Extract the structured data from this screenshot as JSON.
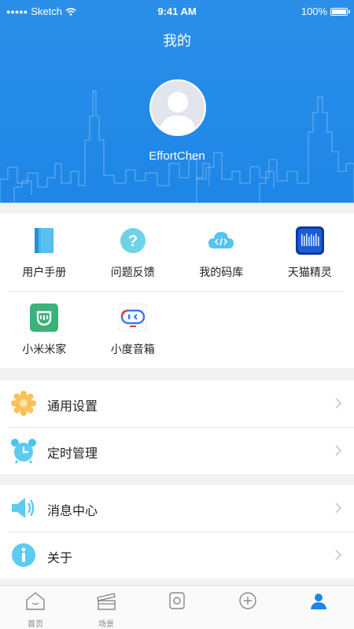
{
  "status_bar": {
    "carrier": "Sketch",
    "time": "9:41 AM",
    "battery": "100%"
  },
  "header": {
    "title": "我的",
    "username": "EffortChen"
  },
  "shortcuts": [
    {
      "label": "用户手册",
      "icon": "manual-book-icon"
    },
    {
      "label": "问题反馈",
      "icon": "question-feedback-icon"
    },
    {
      "label": "我的码库",
      "icon": "code-cloud-icon"
    },
    {
      "label": "天猫精灵",
      "icon": "tmall-genie-icon"
    },
    {
      "label": "小米米家",
      "icon": "mijia-icon"
    },
    {
      "label": "小度音箱",
      "icon": "xiaodu-speaker-icon"
    }
  ],
  "settings_group_1": [
    {
      "label": "通用设置",
      "icon": "gear-icon"
    },
    {
      "label": "定时管理",
      "icon": "alarm-clock-icon"
    }
  ],
  "settings_group_2": [
    {
      "label": "消息中心",
      "icon": "speaker-icon"
    },
    {
      "label": "关于",
      "icon": "info-icon"
    }
  ],
  "tabs": [
    {
      "label": "首页",
      "icon": "home-icon",
      "active": false
    },
    {
      "label": "场景",
      "icon": "scene-icon",
      "active": false
    },
    {
      "label": "",
      "icon": "devices-icon",
      "active": false
    },
    {
      "label": "",
      "icon": "smart-icon",
      "active": false
    },
    {
      "label": "",
      "icon": "profile-icon",
      "active": true
    }
  ],
  "colors": {
    "primary": "#1d86e6",
    "background": "#f2f2f2"
  }
}
